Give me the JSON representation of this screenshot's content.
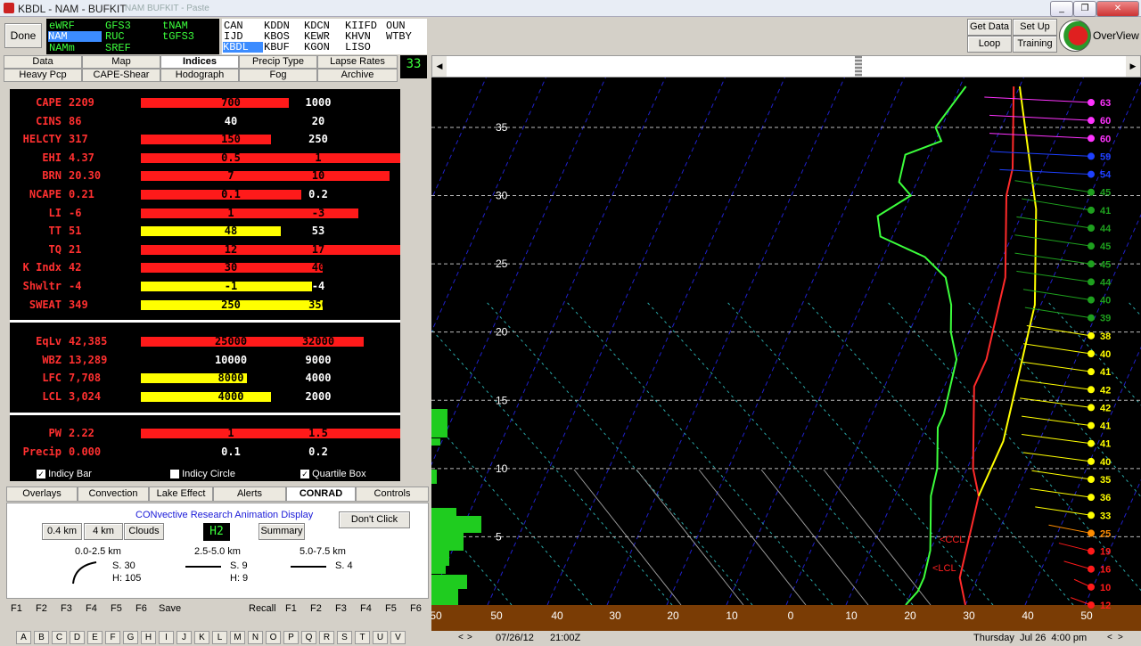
{
  "window": {
    "title": "KBDL - NAM - BUFKIT",
    "subtitle": "NAM BUFKIT - Paste",
    "minimize_glyph": "_",
    "restore_glyph": "❐",
    "close_glyph": "✕"
  },
  "toolbar": {
    "done": "Done",
    "models": [
      {
        "label": "eWRF",
        "color": "#3cff3c"
      },
      {
        "label": "GFS3",
        "color": "#3cff3c"
      },
      {
        "label": "tNAM",
        "color": "#3cff3c"
      },
      {
        "label": "NAM",
        "color": "#ffffff",
        "selected": true
      },
      {
        "label": "RUC",
        "color": "#3cff3c"
      },
      {
        "label": "tGFS3",
        "color": "#3cff3c"
      },
      {
        "label": "NAMm",
        "color": "#3cff3c"
      },
      {
        "label": "SREF",
        "color": "#3cff3c"
      }
    ],
    "stations": [
      "CAN",
      "KDDN",
      "KDCN",
      "KIIFD",
      "OUN",
      "IJD",
      "KBOS",
      "KEWR",
      "KHVN",
      "WTBY",
      "KBDL",
      "KBUF",
      "KGON",
      "LISO"
    ],
    "right_buttons": [
      "Get Data",
      "Set Up",
      "Loop",
      "Training"
    ],
    "overview": "OverView"
  },
  "tabs_row1": [
    "Data",
    "Map",
    "Indices",
    "Precip Type",
    "Lapse Rates"
  ],
  "tabs_row2": [
    "Heavy Pcp",
    "CAPE-Shear",
    "Hodograph",
    "Fog",
    "Archive"
  ],
  "frame_number": "33",
  "indices": [
    {
      "label": "CAPE",
      "value": "2209",
      "color": "red",
      "frac": 0.57,
      "q1": "700",
      "q2": "1000"
    },
    {
      "label": "CINS",
      "value": "86",
      "color": "none",
      "frac": 0,
      "q1": "40",
      "q2": "20"
    },
    {
      "label": "HELCTY",
      "value": "317",
      "color": "red",
      "frac": 0.5,
      "q1": "150",
      "q2": "250"
    },
    {
      "label": "EHI",
      "value": "4.37",
      "color": "red",
      "frac": 1.0,
      "q1": "0.5",
      "q2": "1"
    },
    {
      "label": "BRN",
      "value": "20.30",
      "color": "red",
      "frac": 0.96,
      "q1": "7",
      "q2": "10"
    },
    {
      "label": "NCAPE",
      "value": "0.21",
      "color": "red",
      "frac": 0.62,
      "q1": "0.1",
      "q2": "0.2"
    },
    {
      "label": "LI",
      "value": "-6",
      "color": "red",
      "frac": 0.84,
      "q1": "1",
      "q2": "-3"
    },
    {
      "label": "TT",
      "value": "51",
      "color": "yellow",
      "frac": 0.54,
      "q1": "48",
      "q2": "53"
    },
    {
      "label": "TQ",
      "value": "21",
      "color": "red",
      "frac": 1.0,
      "q1": "12",
      "q2": "17"
    },
    {
      "label": "K Indx",
      "value": "42",
      "color": "red",
      "frac": 0.7,
      "q1": "30",
      "q2": "40"
    },
    {
      "label": "Shwltr",
      "value": "-4",
      "color": "yellow",
      "frac": 0.66,
      "q1": "-1",
      "q2": "-4"
    },
    {
      "label": "SWEAT",
      "value": "349",
      "color": "yellow",
      "frac": 0.7,
      "q1": "250",
      "q2": "350"
    }
  ],
  "indices2": [
    {
      "label": "EqLv",
      "value": "42,385",
      "color": "red",
      "frac": 0.86,
      "q1": "25000",
      "q2": "32000"
    },
    {
      "label": "WBZ",
      "value": "13,289",
      "color": "none",
      "frac": 0,
      "q1": "10000",
      "q2": "9000"
    },
    {
      "label": "LFC",
      "value": "7,708",
      "color": "yellow",
      "frac": 0.41,
      "q1": "8000",
      "q2": "4000"
    },
    {
      "label": "LCL",
      "value": "3,024",
      "color": "yellow",
      "frac": 0.5,
      "q1": "4000",
      "q2": "2000"
    }
  ],
  "indices3": [
    {
      "label": "PW",
      "value": "2.22",
      "color": "red",
      "frac": 1.0,
      "q1": "1",
      "q2": "1.5"
    },
    {
      "label": "Precip",
      "value": "0.000",
      "color": "none",
      "frac": 0,
      "q1": "0.1",
      "q2": "0.2"
    }
  ],
  "checkboxes": [
    {
      "label": "Indicy Bar",
      "checked": true
    },
    {
      "label": "Indicy Circle",
      "checked": false
    },
    {
      "label": "Quartile Box",
      "checked": true
    }
  ],
  "bottom_tabs": [
    "Overlays",
    "Convection",
    "Lake Effect",
    "Alerts",
    "CONRAD",
    "Controls"
  ],
  "conrad": {
    "title": "CONvective Research Animation Display",
    "dont_click": "Don't Click",
    "layer_buttons": [
      "0.4 km",
      "4 km",
      "Clouds"
    ],
    "h_label": "H2",
    "summary": "Summary",
    "layers": [
      {
        "range": "0.0-2.5 km",
        "s": "S. 30",
        "h": "H: 105"
      },
      {
        "range": "2.5-5.0 km",
        "s": "S. 9",
        "h": "H: 9"
      },
      {
        "range": "5.0-7.5 km",
        "s": "S. 4",
        "h": ""
      }
    ]
  },
  "fkeys_left": [
    "F1",
    "F2",
    "F3",
    "F4",
    "F5",
    "F6",
    "Save"
  ],
  "fkeys_right": [
    "Recall",
    "F1",
    "F2",
    "F3",
    "F4",
    "F5",
    "F6"
  ],
  "letters": [
    "A",
    "B",
    "C",
    "D",
    "E",
    "F",
    "G",
    "H",
    "I",
    "J",
    "K",
    "L",
    "M",
    "N",
    "O",
    "P",
    "Q",
    "R",
    "S",
    "T",
    "U",
    "V"
  ],
  "status": {
    "date": "07/26/12",
    "time": "21:00Z",
    "local": "Thursday  Jul 26  4:00 pm"
  },
  "skewt": {
    "x_ticks": [
      "50",
      "50",
      "40",
      "30",
      "20",
      "10",
      "0",
      "10",
      "20",
      "30",
      "40",
      "50"
    ],
    "y_ticks": [
      "35",
      "30",
      "25",
      "20",
      "15",
      "10",
      "5"
    ],
    "labels": {
      "ccl": "<CCL",
      "lcl": "<LCL"
    },
    "wind_speeds": [
      "63",
      "60",
      "60",
      "59",
      "54",
      "45",
      "41",
      "44",
      "45",
      "45",
      "44",
      "40",
      "39",
      "38",
      "40",
      "41",
      "42",
      "42",
      "41",
      "41",
      "40",
      "35",
      "36",
      "33",
      "25",
      "19",
      "16",
      "10",
      "12"
    ]
  },
  "chart_data": {
    "type": "line",
    "title": "",
    "xlabel": "",
    "ylabel": "",
    "xlim": [
      -50,
      50
    ],
    "ylim": [
      0,
      38
    ],
    "series": [
      {
        "color": "#3cff3c",
        "x": [
          -9,
          -11,
          -9,
          -14,
          -13,
          -10,
          -14,
          -12,
          -3,
          2,
          5,
          7,
          10,
          11,
          12,
          12,
          13,
          15,
          16,
          18,
          20,
          21,
          21,
          20
        ],
        "y": [
          38,
          35,
          34,
          33,
          31,
          30,
          28.5,
          27,
          25.5,
          24,
          22,
          20,
          18,
          16,
          14,
          13,
          12,
          10,
          8,
          6,
          4,
          2,
          1,
          0
        ]
      },
      {
        "color": "#ff2a2a",
        "x": [
          -1,
          1,
          3,
          5,
          6,
          8,
          10,
          12,
          13,
          14,
          15,
          15,
          17,
          19,
          21,
          24,
          25,
          26,
          27,
          30
        ],
        "y": [
          38,
          36,
          34,
          32,
          30,
          28,
          26,
          24,
          22,
          20,
          18,
          16,
          14,
          12,
          10,
          8,
          6,
          4,
          2,
          0
        ]
      },
      {
        "color": "#ffff00",
        "x": [
          0,
          4,
          8,
          12,
          15,
          17,
          19,
          20,
          21,
          22,
          23,
          24,
          24
        ],
        "y": [
          38,
          35,
          32,
          29,
          26,
          24,
          22,
          20,
          18,
          16,
          14,
          12,
          8
        ]
      }
    ]
  }
}
